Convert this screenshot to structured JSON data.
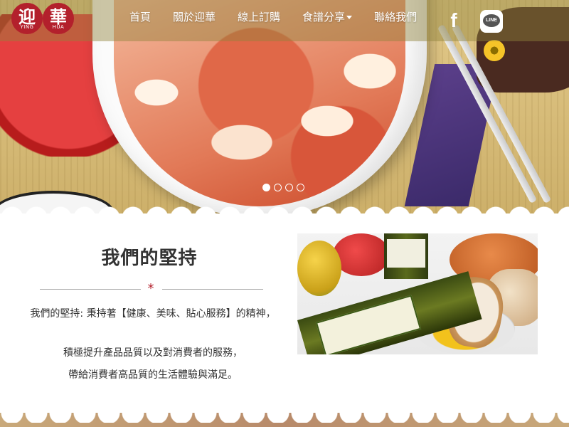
{
  "brand": {
    "seal_chars": [
      "迎",
      "華"
    ],
    "seal_sub": [
      "YING",
      "HUA"
    ],
    "color": "#b3202c"
  },
  "nav": {
    "items": [
      {
        "label": "首頁"
      },
      {
        "label": "關於迎華"
      },
      {
        "label": "線上訂購"
      },
      {
        "label": "食譜分享",
        "has_dropdown": true
      },
      {
        "label": "聯絡我們"
      }
    ],
    "social": {
      "facebook_glyph": "f",
      "line_text": "LINE"
    }
  },
  "carousel": {
    "slides": 4,
    "active_index": 0
  },
  "section": {
    "title": "我們的堅持",
    "star": "*",
    "paragraphs": [
      "我們的堅持: 秉持著【健康、美味、貼心服務】的精神，",
      "積極提升產品品質以及對消費者的服務，",
      "帶給消費者高品質的生活體驗與滿足。"
    ]
  }
}
